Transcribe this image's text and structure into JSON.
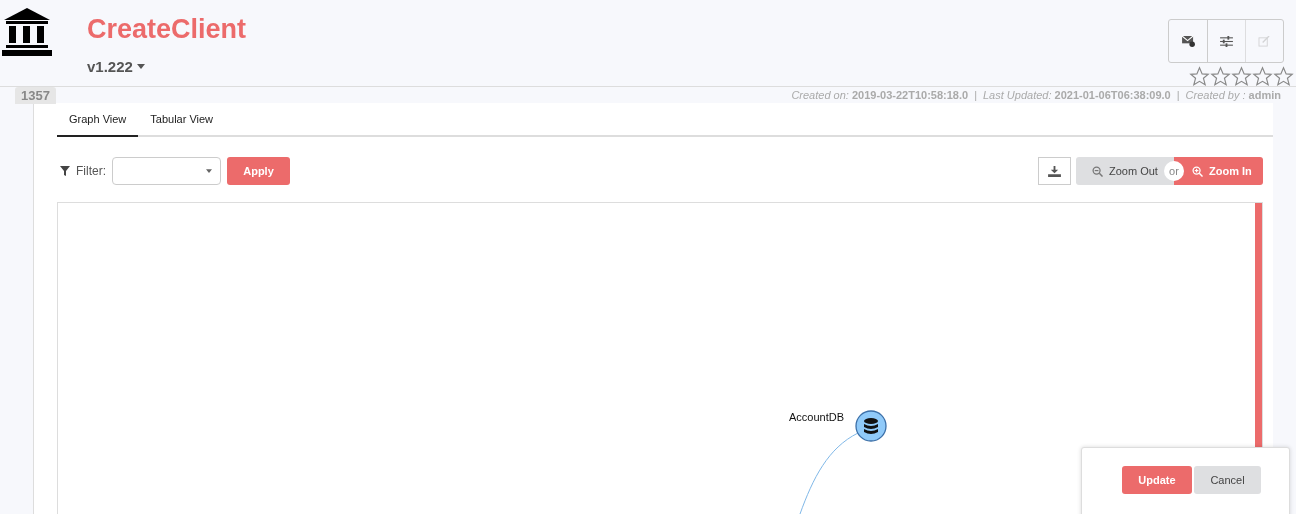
{
  "app": {
    "title": "CreateClient",
    "version": "v1.222",
    "id_badge": "1357",
    "stars": 0
  },
  "actions": [
    {
      "kind": "mail",
      "disabled": false
    },
    {
      "kind": "sliders",
      "disabled": false
    },
    {
      "kind": "edit",
      "disabled": true
    }
  ],
  "meta": {
    "separator": "|",
    "items": [
      "*Created on:* **2019-03-22T10:58:18.0**",
      "*Last Updated:* **2021-01-06T06:38:09.0**",
      "*Created by :* **admin**"
    ]
  },
  "tabs": [
    {
      "label": "Graph View",
      "selected": true
    },
    {
      "label": "Tabular View",
      "selected": false
    }
  ],
  "filter": {
    "label": "Filter:",
    "apply": "Apply"
  },
  "zoom": {
    "out": "Zoom Out",
    "or": "or",
    "in": "Zoom In"
  },
  "graph": {
    "nodes": [
      {
        "label": "AccountDB",
        "kind": "database"
      }
    ]
  },
  "dialog": {
    "buttons": [
      {
        "label": "Update",
        "kind": "primary"
      },
      {
        "label": "Cancel",
        "kind": "secondary"
      }
    ]
  }
}
